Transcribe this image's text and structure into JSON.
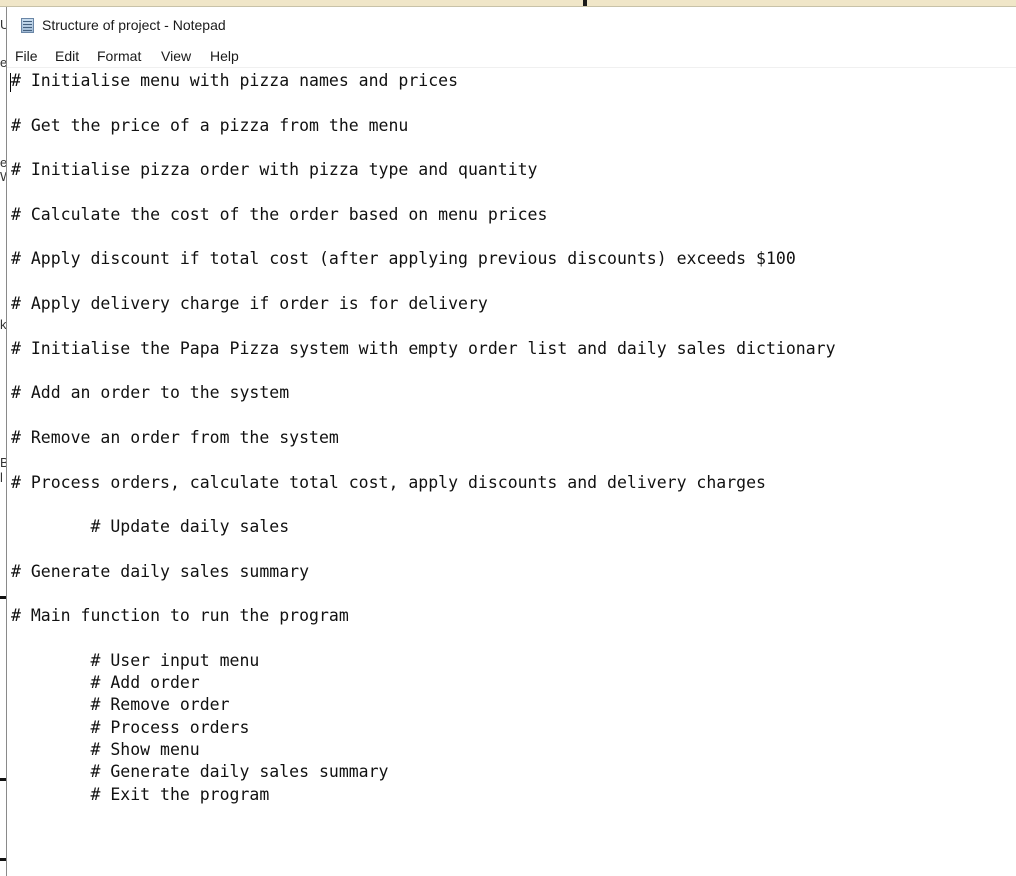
{
  "window": {
    "title": "Structure of project - Notepad",
    "icon": "notepad-icon"
  },
  "menu": {
    "file": "File",
    "edit": "Edit",
    "format": "Format",
    "view": "View",
    "help": "Help"
  },
  "editor": {
    "lines": [
      "# Initialise menu with pizza names and prices",
      "# Get the price of a pizza from the menu",
      "# Initialise pizza order with pizza type and quantity",
      "# Calculate the cost of the order based on menu prices",
      "# Apply discount if total cost (after applying previous discounts) exceeds $100",
      "# Apply delivery charge if order is for delivery",
      "# Initialise the Papa Pizza system with empty order list and daily sales dictionary",
      "# Add an order to the system",
      "# Remove an order from the system",
      "# Process orders, calculate total cost, apply discounts and delivery charges",
      "        # Update daily sales",
      "# Generate daily sales summary",
      "# Main function to run the program",
      "        # User input menu",
      "        # Add order",
      "        # Remove order",
      "        # Process orders",
      "        # Show menu",
      "        # Generate daily sales summary",
      "        # Exit the program"
    ]
  },
  "background_edge": {
    "glyphs": [
      "U",
      "e",
      "e",
      "W",
      "k",
      "B",
      "l"
    ]
  }
}
